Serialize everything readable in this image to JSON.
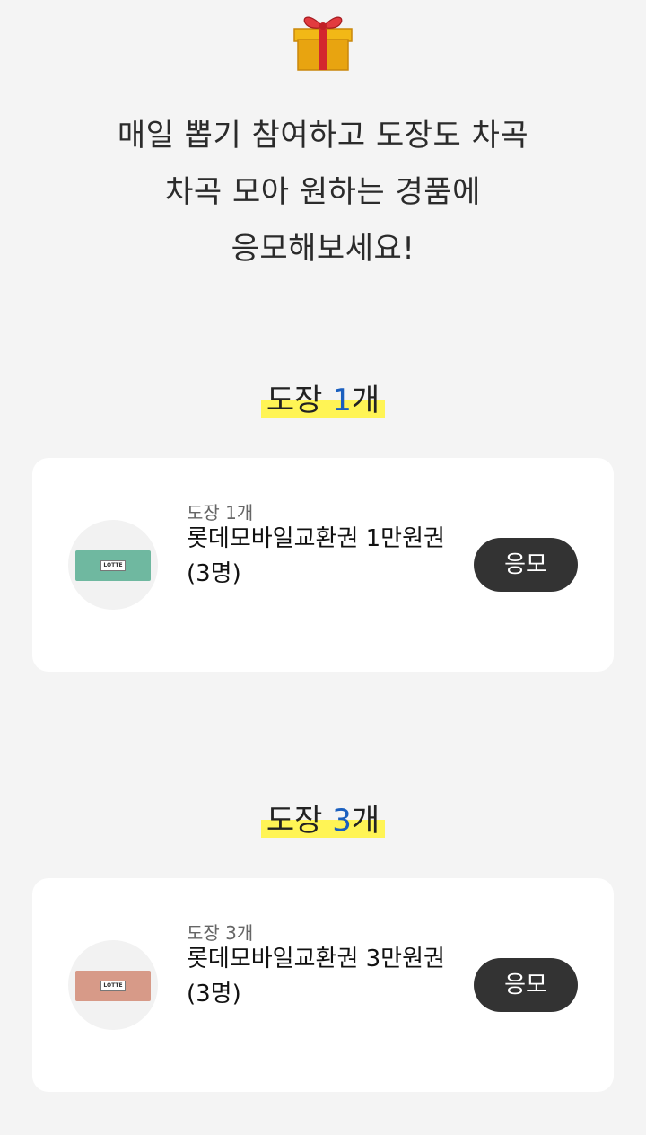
{
  "header": {
    "gift_icon": "gift-box-icon",
    "intro_lines": [
      "매일 뽑기 참여하고 도장도 차곡",
      "차곡 모아 원하는 경품에",
      "응모해보세요!"
    ]
  },
  "sections": [
    {
      "title_prefix": "도장 ",
      "title_number": "1",
      "title_suffix": "개",
      "card": {
        "stamp_label": "도장 1개",
        "prize_name": "롯데모바일교환권 1만원권",
        "winners": "(3명)",
        "apply_label": "응모",
        "voucher_color": "#6fb8a0",
        "voucher_text": "LOTTE"
      }
    },
    {
      "title_prefix": "도장 ",
      "title_number": "3",
      "title_suffix": "개",
      "card": {
        "stamp_label": "도장 3개",
        "prize_name": "롯데모바일교환권 3만원권",
        "winners": "(3명)",
        "apply_label": "응모",
        "voucher_color": "#d79a88",
        "voucher_text": "LOTTE"
      }
    }
  ],
  "colors": {
    "background": "#f4f4f4",
    "highlight": "#fff455",
    "number_accent": "#1a5fbf",
    "button": "#333333"
  }
}
